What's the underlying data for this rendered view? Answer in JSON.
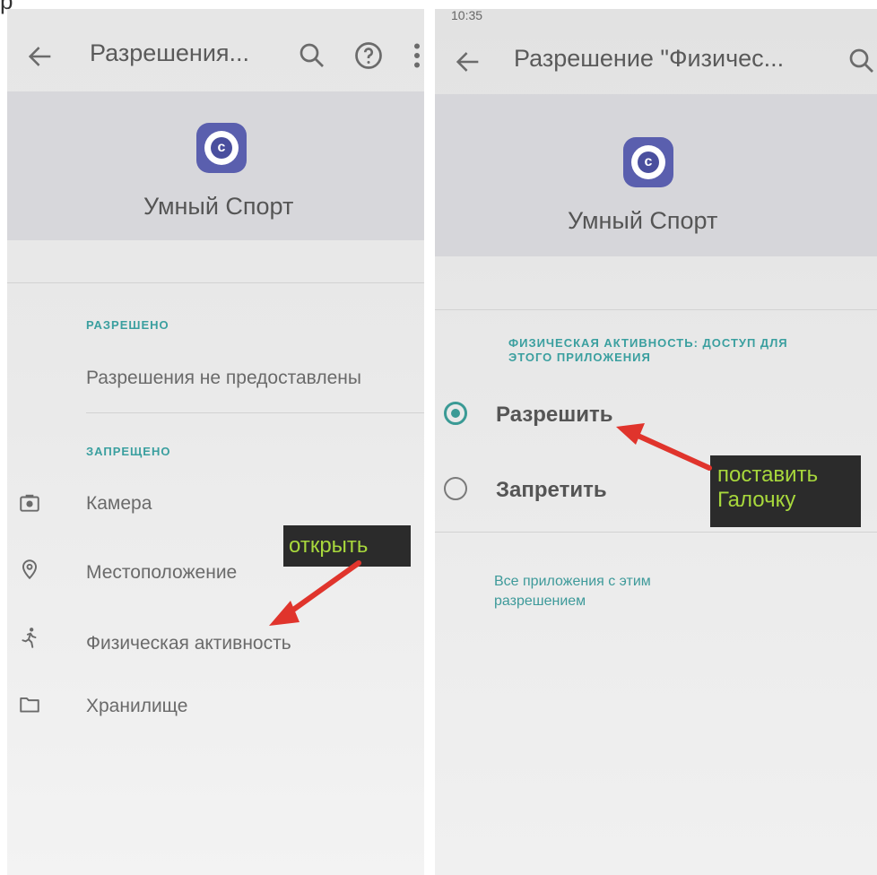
{
  "left": {
    "appbar": {
      "title": "Разрешения..."
    },
    "app_name": "Умный Спорт",
    "allowed": {
      "label": "РАЗРЕШЕНО",
      "empty_text": "Разрешения не предоставлены"
    },
    "denied": {
      "label": "ЗАПРЕЩЕНО",
      "items": [
        {
          "label": "Камера",
          "icon": "camera-icon"
        },
        {
          "label": "Местоположение",
          "icon": "location-pin-icon"
        },
        {
          "label": "Физическая активность",
          "icon": "running-person-icon"
        },
        {
          "label": "Хранилище",
          "icon": "folder-icon"
        }
      ]
    },
    "annotation": "открыть"
  },
  "right": {
    "statusbar": {
      "time": "10:35"
    },
    "appbar": {
      "title": "Разрешение \"Физичес..."
    },
    "app_name": "Умный Спорт",
    "section": {
      "line1": "ФИЗИЧЕСКАЯ АКТИВНОСТЬ: ДОСТУП ДЛЯ",
      "line2": "ЭТОГО ПРИЛОЖЕНИЯ"
    },
    "options": [
      {
        "label": "Разрешить",
        "selected": true
      },
      {
        "label": "Запретить",
        "selected": false
      }
    ],
    "link": {
      "line1": "Все приложения с этим",
      "line2": "разрешением"
    },
    "annotation": {
      "line1": "поставить",
      "line2": "Галочку"
    }
  },
  "colors": {
    "accent": "#3a9f9f",
    "app_icon": "#5a5fae",
    "callout_bg": "#2b2b2b",
    "callout_text": "#a8d83c",
    "arrow": "#e0342c"
  }
}
